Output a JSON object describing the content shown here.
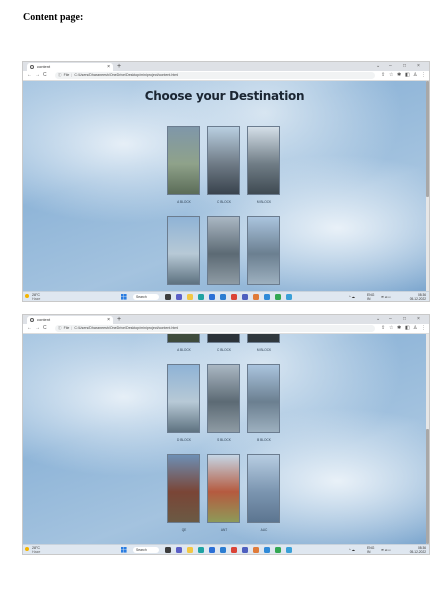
{
  "heading": "Content page:",
  "browser": {
    "tab_title": "content",
    "tab_close": "×",
    "new_tab": "+",
    "window_controls": [
      "⌄",
      "–",
      "□",
      "×"
    ],
    "nav": [
      "←",
      "→",
      "C"
    ],
    "url_prefix": "File",
    "url_separator": "|",
    "url": "C:/Users/Dharaneesh/OneDrive/Desktop/miniproject/content.html",
    "toolbar_icons": [
      "share-icon",
      "star-icon",
      "extensions-icon",
      "sidepanel-icon",
      "profile-icon",
      "menu-icon"
    ],
    "toolbar_glyphs": [
      "⇪",
      "☆",
      "✱",
      "◧",
      "♙",
      "⋮"
    ]
  },
  "page": {
    "title": "Choose your Destination"
  },
  "screens": [
    {
      "show_title": true,
      "rows": [
        {
          "cards": [
            {
              "caption": "A BLOCK",
              "colors": [
                "#7f97a9",
                "#8fa28a",
                "#5b6c58"
              ]
            },
            {
              "caption": "C BLOCK",
              "colors": [
                "#b9cfe1",
                "#6f7b86",
                "#39434d"
              ]
            },
            {
              "caption": "M BLOCK",
              "colors": [
                "#d4dfe8",
                "#707d86",
                "#3f4a52"
              ]
            }
          ]
        },
        {
          "cards": [
            {
              "caption": "",
              "colors": [
                "#8fb3d6",
                "#b7c9d6",
                "#5e7280"
              ]
            },
            {
              "caption": "",
              "colors": [
                "#aab7c3",
                "#5c6a74",
                "#8e9ba4"
              ]
            },
            {
              "caption": "",
              "colors": [
                "#aac4de",
                "#6b7f90",
                "#9db0bf"
              ]
            }
          ]
        }
      ],
      "thumb_top_frac": 0.0,
      "thumb_size_frac": 0.55
    },
    {
      "show_title": false,
      "rows": [
        {
          "cards": [
            {
              "caption": "A BLOCK",
              "colors": [
                "#5b6c58",
                "#4a5a47",
                "#3e4a3b"
              ]
            },
            {
              "caption": "C BLOCK",
              "colors": [
                "#39434d",
                "#30383f",
                "#2b3238"
              ]
            },
            {
              "caption": "M BLOCK",
              "colors": [
                "#3f4a52",
                "#384148",
                "#2f373c"
              ]
            }
          ]
        },
        {
          "cards": [
            {
              "caption": "D BLOCK",
              "colors": [
                "#8fb3d6",
                "#b7c9d6",
                "#5e7280"
              ]
            },
            {
              "caption": "S BLOCK",
              "colors": [
                "#aab7c3",
                "#5c6a74",
                "#8e9ba4"
              ]
            },
            {
              "caption": "B BLOCK",
              "colors": [
                "#aac4de",
                "#6b7f90",
                "#9db0bf"
              ]
            }
          ]
        },
        {
          "cards": [
            {
              "caption": "QE",
              "colors": [
                "#6d8fb5",
                "#7a4536",
                "#6b5a44"
              ]
            },
            {
              "caption": "ANT",
              "colors": [
                "#c5d6e6",
                "#b55a3f",
                "#8e9a58"
              ]
            },
            {
              "caption": "AUC",
              "colors": [
                "#b7cde2",
                "#7b95b0",
                "#5c7590"
              ]
            }
          ]
        }
      ],
      "thumb_top_frac": 0.45,
      "thumb_size_frac": 0.55
    }
  ],
  "taskbar": {
    "temperature": "28°C",
    "weather": "Haze",
    "search_label": "Search",
    "apps": [
      {
        "name": "taskview-icon",
        "color": "#3d3d3d"
      },
      {
        "name": "chat-icon",
        "color": "#5b5fc7"
      },
      {
        "name": "explorer-icon",
        "color": "#f2c744"
      },
      {
        "name": "edge-icon",
        "color": "#1fa3a3"
      },
      {
        "name": "store-icon",
        "color": "#2b6fd6"
      },
      {
        "name": "office-icon",
        "color": "#2c7dd1"
      },
      {
        "name": "chrome-icon",
        "color": "#db4437"
      },
      {
        "name": "teams-icon",
        "color": "#4e5fbf"
      },
      {
        "name": "paint-icon",
        "color": "#e07b39"
      },
      {
        "name": "vscode-icon",
        "color": "#2f8ad8"
      },
      {
        "name": "chrome-alt-icon",
        "color": "#34a853"
      },
      {
        "name": "ai-icon",
        "color": "#3aa0d8"
      }
    ],
    "tray_glyphs": "^ ☁",
    "lang_top": "ENG",
    "lang_bottom": "IN",
    "sys_glyphs": "≋ ◂ ▭",
    "time": "08:36",
    "date": "05-12-2022"
  }
}
